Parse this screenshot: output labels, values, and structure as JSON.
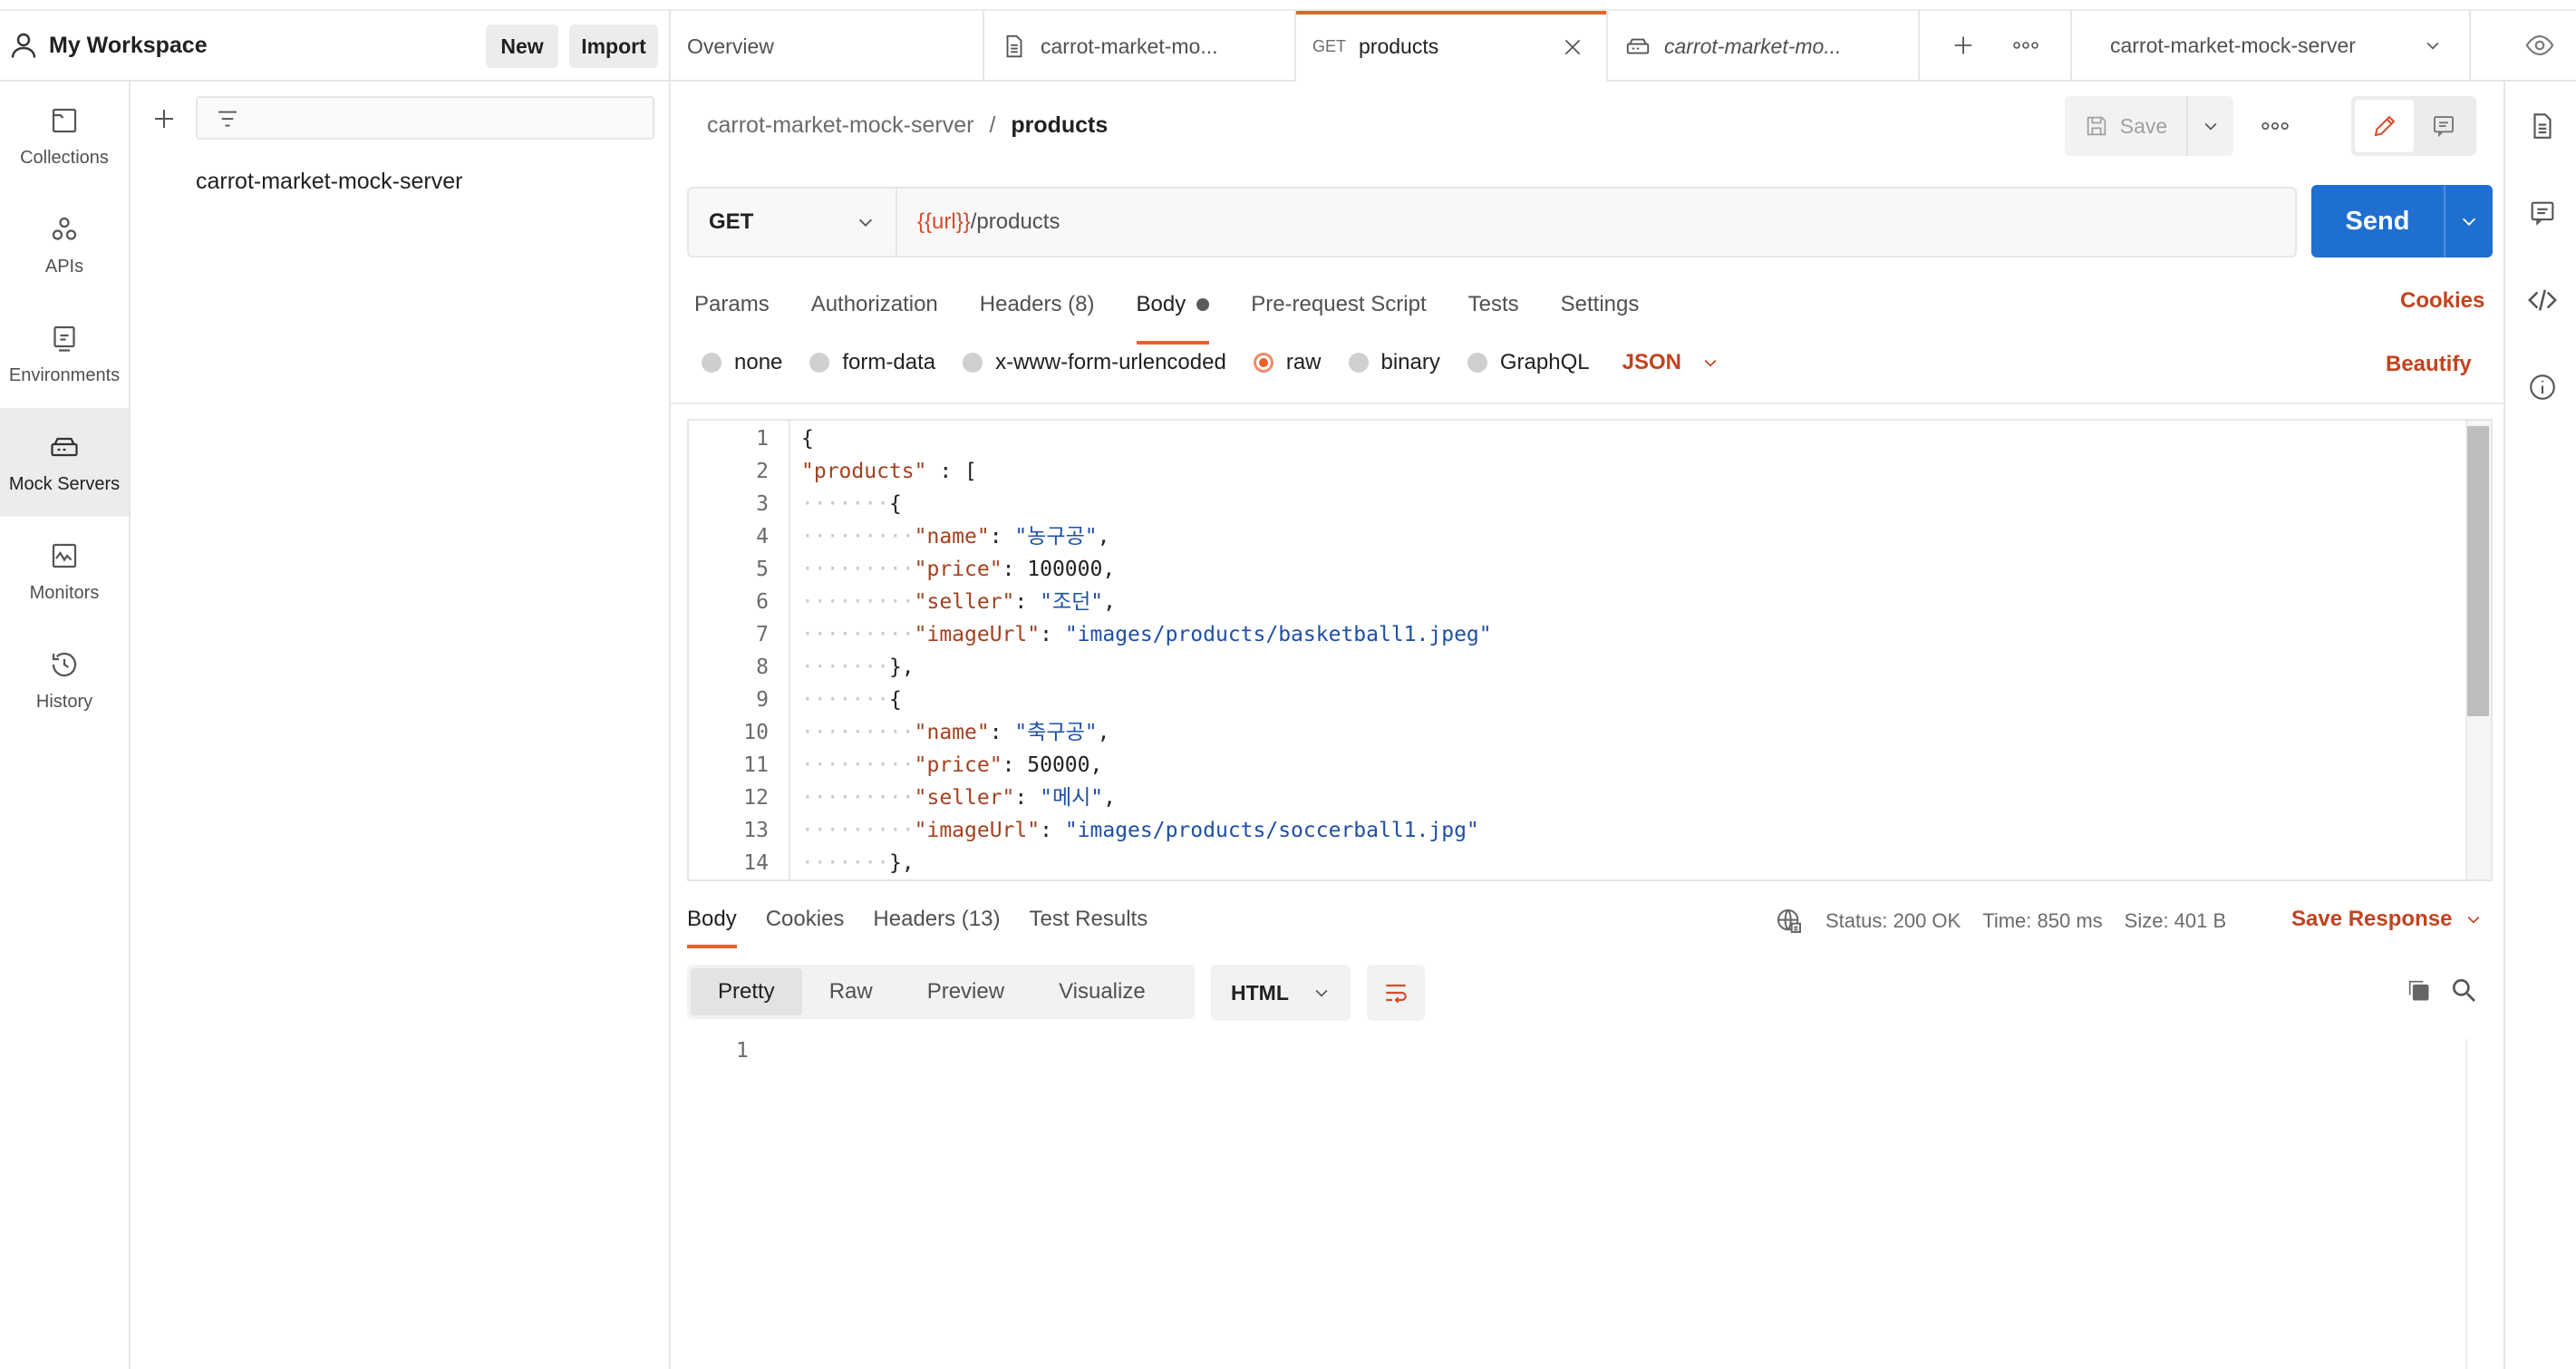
{
  "workspace": {
    "title": "My Workspace",
    "new_label": "New",
    "import_label": "Import"
  },
  "tabs": [
    {
      "label": "Overview"
    },
    {
      "label": "carrot-market-mo...",
      "icon": "document-icon"
    },
    {
      "method": "GET",
      "label": "products",
      "active": true
    },
    {
      "label": "carrot-market-mo...",
      "icon": "mock-server-icon",
      "italic": true
    }
  ],
  "environment": {
    "selected": "carrot-market-mock-server"
  },
  "sidebar": {
    "items": [
      {
        "label": "Collections",
        "icon": "collections-icon"
      },
      {
        "label": "APIs",
        "icon": "apis-icon"
      },
      {
        "label": "Environments",
        "icon": "environments-icon"
      },
      {
        "label": "Mock Servers",
        "icon": "mock-server-icon",
        "active": true
      },
      {
        "label": "Monitors",
        "icon": "monitors-icon"
      },
      {
        "label": "History",
        "icon": "history-icon"
      }
    ]
  },
  "tree": {
    "items": [
      "carrot-market-mock-server"
    ]
  },
  "request": {
    "breadcrumb_parent": "carrot-market-mock-server",
    "breadcrumb_sep": "/",
    "breadcrumb_current": "products",
    "save_label": "Save",
    "method": "GET",
    "url_var": "{{url}}",
    "url_path": "/products",
    "send_label": "Send",
    "tabs": [
      "Params",
      "Authorization",
      "Headers (8)",
      "Body",
      "Pre-request Script",
      "Tests",
      "Settings"
    ],
    "active_tab": "Body",
    "cookies_label": "Cookies",
    "body_modes": [
      "none",
      "form-data",
      "x-www-form-urlencoded",
      "raw",
      "binary",
      "GraphQL"
    ],
    "body_mode_selected": "raw",
    "language": "JSON",
    "beautify_label": "Beautify"
  },
  "editor": {
    "line_numbers": [
      "1",
      "2",
      "3",
      "4",
      "5",
      "6",
      "7",
      "8",
      "9",
      "10",
      "11",
      "12",
      "13",
      "14"
    ],
    "lines": [
      {
        "indent": "",
        "parts": [
          {
            "t": "n",
            "v": "{"
          }
        ]
      },
      {
        "indent": "",
        "parts": [
          {
            "t": "k",
            "v": "\"products\""
          },
          {
            "t": "n",
            "v": " : ["
          }
        ]
      },
      {
        "indent": "·······",
        "parts": [
          {
            "t": "n",
            "v": "{"
          }
        ]
      },
      {
        "indent": "·········",
        "parts": [
          {
            "t": "k",
            "v": "\"name\""
          },
          {
            "t": "n",
            "v": ": "
          },
          {
            "t": "s",
            "v": "\"농구공\""
          },
          {
            "t": "n",
            "v": ","
          }
        ]
      },
      {
        "indent": "·········",
        "parts": [
          {
            "t": "k",
            "v": "\"price\""
          },
          {
            "t": "n",
            "v": ": 100000,"
          }
        ]
      },
      {
        "indent": "·········",
        "parts": [
          {
            "t": "k",
            "v": "\"seller\""
          },
          {
            "t": "n",
            "v": ": "
          },
          {
            "t": "s",
            "v": "\"조던\""
          },
          {
            "t": "n",
            "v": ","
          }
        ]
      },
      {
        "indent": "·········",
        "parts": [
          {
            "t": "k",
            "v": "\"imageUrl\""
          },
          {
            "t": "n",
            "v": ": "
          },
          {
            "t": "s",
            "v": "\"images/products/basketball1.jpeg\""
          }
        ]
      },
      {
        "indent": "·······",
        "parts": [
          {
            "t": "n",
            "v": "},"
          }
        ]
      },
      {
        "indent": "·······",
        "parts": [
          {
            "t": "n",
            "v": "{"
          }
        ]
      },
      {
        "indent": "·········",
        "parts": [
          {
            "t": "k",
            "v": "\"name\""
          },
          {
            "t": "n",
            "v": ": "
          },
          {
            "t": "s",
            "v": "\"축구공\""
          },
          {
            "t": "n",
            "v": ","
          }
        ]
      },
      {
        "indent": "·········",
        "parts": [
          {
            "t": "k",
            "v": "\"price\""
          },
          {
            "t": "n",
            "v": ": 50000,"
          }
        ]
      },
      {
        "indent": "·········",
        "parts": [
          {
            "t": "k",
            "v": "\"seller\""
          },
          {
            "t": "n",
            "v": ": "
          },
          {
            "t": "s",
            "v": "\"메시\""
          },
          {
            "t": "n",
            "v": ","
          }
        ]
      },
      {
        "indent": "·········",
        "parts": [
          {
            "t": "k",
            "v": "\"imageUrl\""
          },
          {
            "t": "n",
            "v": ": "
          },
          {
            "t": "s",
            "v": "\"images/products/soccerball1.jpg\""
          }
        ]
      },
      {
        "indent": "·······",
        "parts": [
          {
            "t": "n",
            "v": "},"
          }
        ]
      }
    ]
  },
  "response": {
    "tabs": [
      "Body",
      "Cookies",
      "Headers (13)",
      "Test Results"
    ],
    "active_tab": "Body",
    "status": "Status: 200 OK",
    "time": "Time: 850 ms",
    "size": "Size: 401 B",
    "save_label": "Save Response",
    "views": [
      "Pretty",
      "Raw",
      "Preview",
      "Visualize"
    ],
    "view_selected": "Pretty",
    "format": "HTML",
    "line_numbers": [
      "1"
    ]
  },
  "colors": {
    "accent": "#e8612c",
    "link": "#c2431f",
    "send": "#1f6fd0"
  }
}
